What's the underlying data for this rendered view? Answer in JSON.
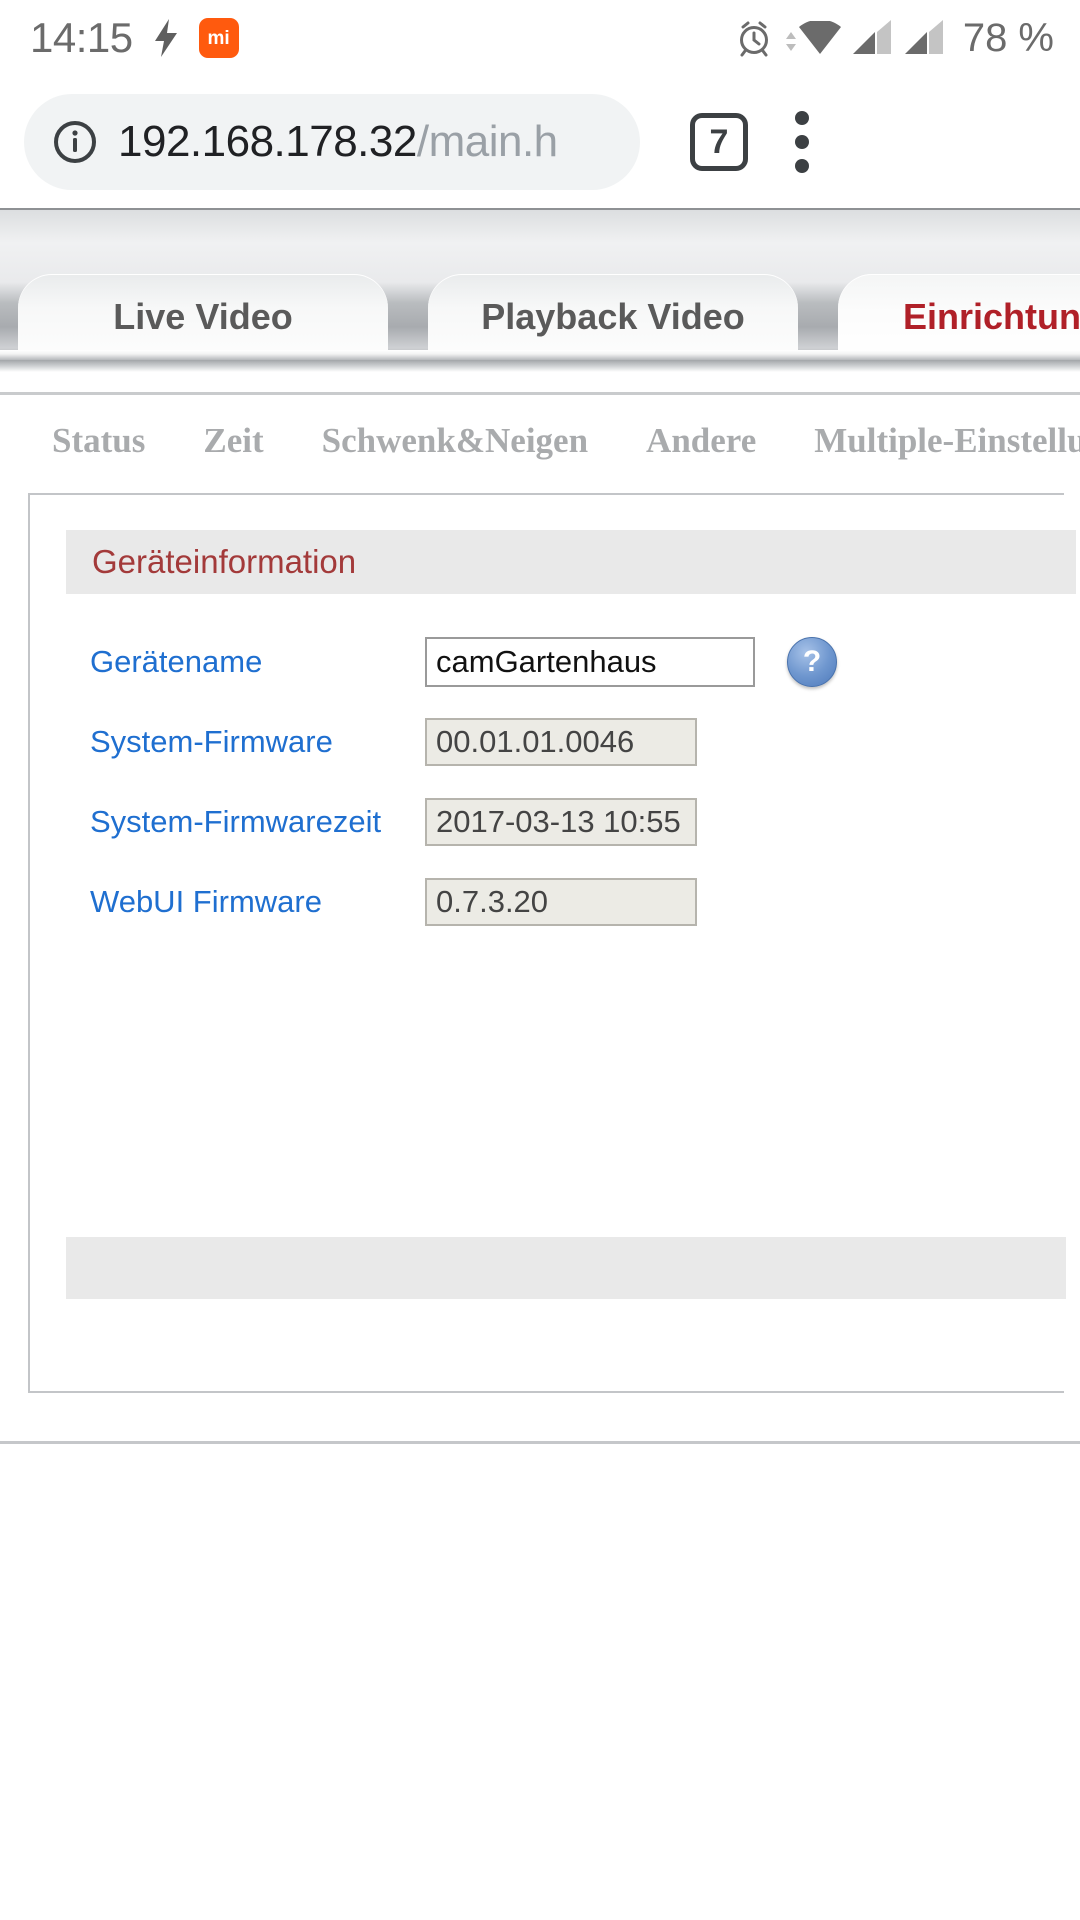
{
  "status_bar": {
    "clock": "14:15",
    "battery": "78 %",
    "icons": {
      "charging": "lightning-bolt-icon",
      "app": "mi-app-icon",
      "app_label": "mi",
      "alarm": "alarm-clock-icon",
      "wifi": "wifi-icon",
      "signal_1": "signal-bars-icon",
      "signal_2": "signal-bars-icon"
    }
  },
  "browser": {
    "url_host": "192.168.178.32",
    "url_path": "/main.h",
    "security_icon": "info-circle-icon",
    "tab_count": "7",
    "menu_icon": "more-vertical-icon"
  },
  "camera_ui": {
    "tabs": [
      {
        "label": "Live Video",
        "active": false
      },
      {
        "label": "Playback Video",
        "active": false
      },
      {
        "label": "Einrichtung",
        "active": true
      }
    ],
    "subnav": [
      "Status",
      "Zeit",
      "Schwenk&Neigen",
      "Andere",
      "Multiple-Einstellungen"
    ],
    "panel": {
      "title": "Geräteinformation",
      "rows": [
        {
          "label": "Gerätename",
          "value": "camGartenhaus",
          "readonly": false,
          "help": "?"
        },
        {
          "label": "System-Firmware",
          "value": "00.01.01.0046",
          "readonly": true
        },
        {
          "label": "System-Firmwarezeit",
          "value": "2017-03-13 10:55",
          "readonly": true
        },
        {
          "label": "WebUI Firmware",
          "value": "0.7.3.20",
          "readonly": true
        }
      ]
    }
  },
  "colors": {
    "accent_red": "#b02028",
    "panel_title": "#a33a3a",
    "link_blue": "#1f6fd0",
    "mi_orange": "#ff5a0e"
  }
}
